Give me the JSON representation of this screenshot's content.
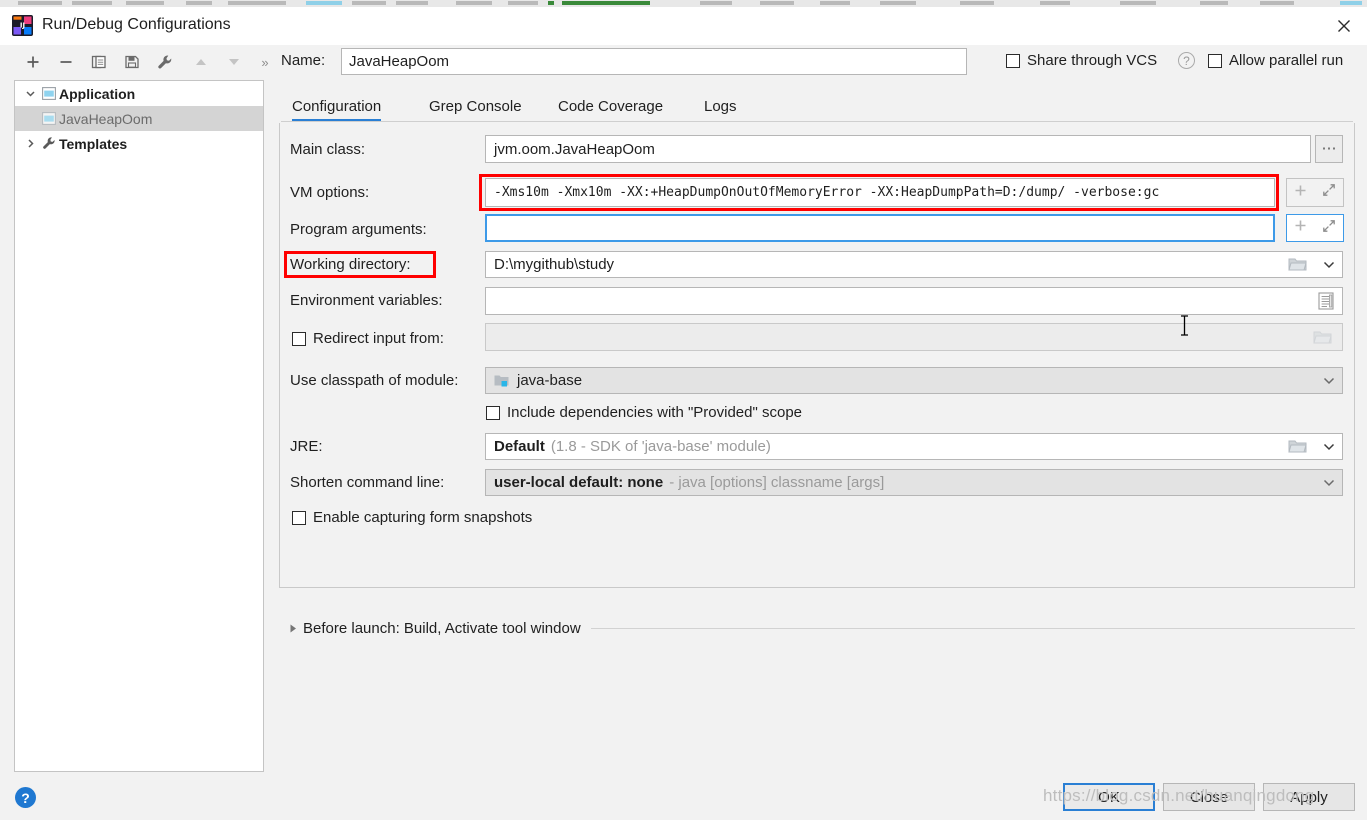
{
  "window": {
    "title": "Run/Debug Configurations",
    "app_icon": "intellij-idea-icon",
    "close_label": "✕"
  },
  "toolbar": {
    "buttons": [
      {
        "name": "add-configuration-button",
        "glyph": "+",
        "enabled": true
      },
      {
        "name": "remove-configuration-button",
        "glyph": "−",
        "enabled": true
      },
      {
        "name": "copy-configuration-button",
        "glyph": "copy-icon",
        "enabled": true
      },
      {
        "name": "save-configuration-button",
        "glyph": "save-icon",
        "enabled": true
      },
      {
        "name": "edit-templates-button",
        "glyph": "wrench-icon",
        "enabled": true
      },
      {
        "name": "move-up-button",
        "glyph": "triangle-up-icon",
        "enabled": false
      },
      {
        "name": "move-down-button",
        "glyph": "triangle-down-icon",
        "enabled": false
      },
      {
        "name": "more-options-button",
        "glyph": "»",
        "enabled": true
      }
    ]
  },
  "tree": {
    "nodes": [
      {
        "label": "Application",
        "twisty": "chevron-down",
        "icon": "application-icon",
        "selected": false,
        "child": false
      },
      {
        "label": "JavaHeapOom",
        "twisty": "",
        "icon": "application-icon",
        "selected": true,
        "child": true
      },
      {
        "label": "Templates",
        "twisty": "chevron-right",
        "icon": "wrench-icon",
        "selected": false,
        "child": false
      }
    ]
  },
  "help": {
    "glyph": "?"
  },
  "name_row": {
    "label": "Name:",
    "value": "JavaHeapOom",
    "placeholder": "",
    "share_vcs_label": "Share through VCS",
    "share_vcs_checked": false,
    "help_glyph": "?",
    "allow_parallel_label": "Allow parallel run",
    "allow_parallel_checked": false
  },
  "tabs": [
    {
      "label": "Configuration",
      "active": true
    },
    {
      "label": "Grep Console",
      "active": false
    },
    {
      "label": "Code Coverage",
      "active": false
    },
    {
      "label": "Logs",
      "active": false
    }
  ],
  "form": {
    "main_class": {
      "label": "Main class:",
      "value": "jvm.oom.JavaHeapOom",
      "browse_glyph": "⋯"
    },
    "vm_options": {
      "label": "VM options:",
      "value": "-Xms10m -Xmx10m -XX:+HeapDumpOnOutOfMemoryError -XX:HeapDumpPath=D:/dump/ -verbose:gc",
      "highlighted": true
    },
    "program_arguments": {
      "label": "Program arguments:",
      "value": "",
      "focused": true
    },
    "working_directory": {
      "label": "Working directory:",
      "value": "D:\\mygithub\\study",
      "label_highlighted": true
    },
    "environment_variables": {
      "label": "Environment variables:",
      "value": ""
    },
    "redirect_input": {
      "label": "Redirect input from:",
      "checked": false,
      "value": "",
      "disabled": true
    },
    "use_classpath_of_module": {
      "label": "Use classpath of module:",
      "value": "java-base",
      "icon": "module-folder-icon"
    },
    "include_provided": {
      "label": "Include dependencies with \"Provided\" scope",
      "checked": false
    },
    "jre": {
      "label": "JRE:",
      "value": "Default",
      "hint": "(1.8 - SDK of 'java-base' module)"
    },
    "shorten_command_line": {
      "label": "Shorten command line:",
      "value": "user-local default: none",
      "hint": "- java [options] classname [args]"
    },
    "enable_form_snapshots": {
      "label": "Enable capturing form snapshots",
      "checked": false
    }
  },
  "before_launch": {
    "label": "Before launch: Build, Activate tool window",
    "expanded": false
  },
  "footer": {
    "ok_label": "OK",
    "close_label": "Close",
    "apply_label": "Apply"
  },
  "watermark": {
    "text": "https://blog.csdn.net/huanqingdong"
  },
  "colors": {
    "accent": "#2a7fd4",
    "annotation": "#ff0000",
    "dialog_bg": "#f2f2f2",
    "field_bg": "#ffffff",
    "disabled_fg": "#9a9a9a"
  }
}
